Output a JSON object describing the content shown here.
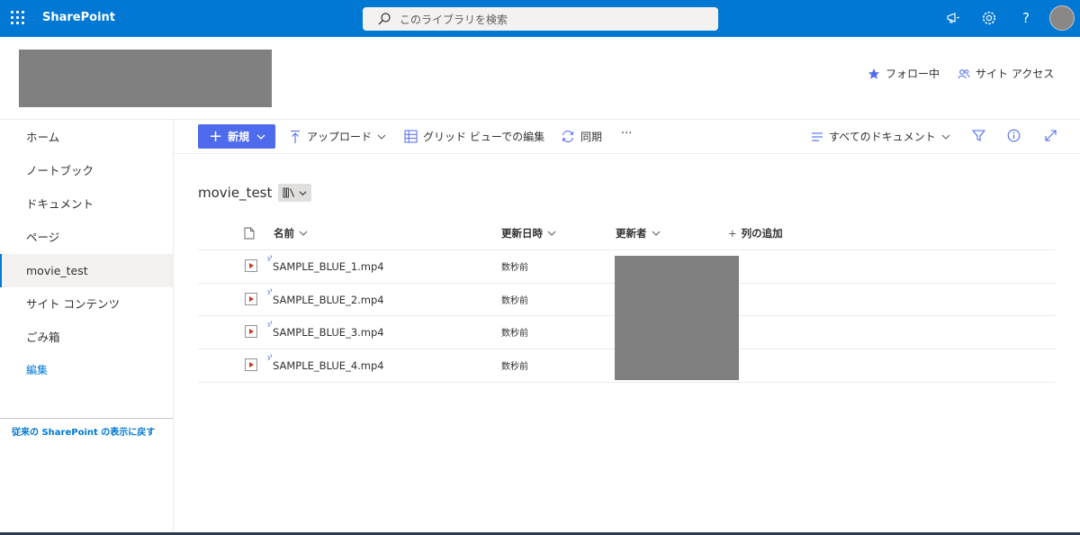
{
  "suite_bar": {
    "app_name": "SharePoint",
    "search_placeholder": "このライブラリを検索",
    "brand_color": "#0078d4",
    "icons": [
      "waffle-icon",
      "megaphone-icon",
      "settings-icon",
      "help-icon",
      "avatar"
    ]
  },
  "site_header": {
    "follow_label": "フォロー中",
    "site_access_label": "サイト アクセス"
  },
  "left_nav": {
    "items": [
      {
        "label": "ホーム",
        "selected": false
      },
      {
        "label": "ノートブック",
        "selected": false
      },
      {
        "label": "ドキュメント",
        "selected": false
      },
      {
        "label": "ページ",
        "selected": false
      },
      {
        "label": "movie_test",
        "selected": true
      },
      {
        "label": "サイト コンテンツ",
        "selected": false
      },
      {
        "label": "ごみ箱",
        "selected": false
      }
    ],
    "edit_label": "編集",
    "classic_link": "従来の SharePoint の表示に戻す"
  },
  "command_bar": {
    "new_label": "新規",
    "upload_label": "アップロード",
    "grid_edit_label": "グリッド ビューでの編集",
    "sync_label": "同期",
    "more_label": "···",
    "view_label": "すべてのドキュメント"
  },
  "library": {
    "title": "movie_test",
    "columns": {
      "name": "名前",
      "modified": "更新日時",
      "modified_by": "更新者",
      "add_column": "列の追加"
    },
    "files": [
      {
        "name": "SAMPLE_BLUE_1.mp4",
        "modified": "数秒前"
      },
      {
        "name": "SAMPLE_BLUE_2.mp4",
        "modified": "数秒前"
      },
      {
        "name": "SAMPLE_BLUE_3.mp4",
        "modified": "数秒前"
      },
      {
        "name": "SAMPLE_BLUE_4.mp4",
        "modified": "数秒前"
      }
    ]
  }
}
